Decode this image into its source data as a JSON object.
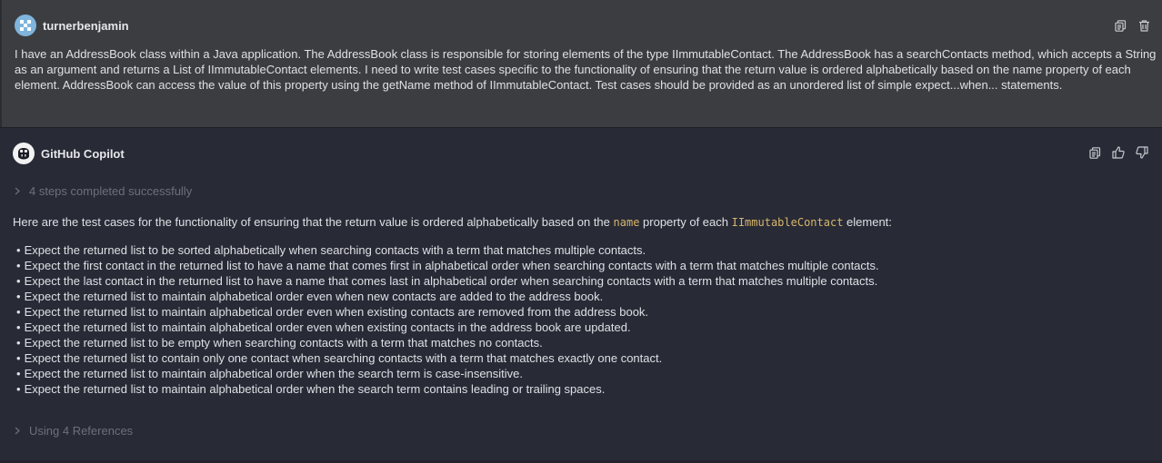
{
  "user_message": {
    "username": "turnerbenjamin",
    "text": "I have an AddressBook class within a Java application. The AddressBook class is responsible for storing elements of the type IImmutableContact. The AddressBook has a searchContacts method, which accepts a String as an argument and returns a List of IImmutableContact elements. I need to write test cases specific to the functionality of ensuring that the return value is ordered alphabetically based on the name property of each element. AddressBook can access the value of this property using the getName method of IImmutableContact. Test cases should be provided as an unordered list of simple expect...when... statements.",
    "actions": [
      "copy-icon",
      "trash-icon"
    ]
  },
  "bot_message": {
    "name": "GitHub Copilot",
    "actions": [
      "copy-icon",
      "thumbs-up-icon",
      "thumbs-down-icon"
    ],
    "steps_label": "4 steps completed successfully",
    "intro": {
      "before": "Here are the test cases for the functionality of ensuring that the return value is ordered alphabetically based on the ",
      "code1": "name",
      "middle": " property of each ",
      "code2": "IImmutableContact",
      "after": " element:"
    },
    "test_cases": [
      "Expect the returned list to be sorted alphabetically when searching contacts with a term that matches multiple contacts.",
      "Expect the first contact in the returned list to have a name that comes first in alphabetical order when searching contacts with a term that matches multiple contacts.",
      "Expect the last contact in the returned list to have a name that comes last in alphabetical order when searching contacts with a term that matches multiple contacts.",
      "Expect the returned list to maintain alphabetical order even when new contacts are added to the address book.",
      "Expect the returned list to maintain alphabetical order even when existing contacts are removed from the address book.",
      "Expect the returned list to maintain alphabetical order even when existing contacts in the address book are updated.",
      "Expect the returned list to be empty when searching contacts with a term that matches no contacts.",
      "Expect the returned list to contain only one contact when searching contacts with a term that matches exactly one contact.",
      "Expect the returned list to maintain alphabetical order when the search term is case-insensitive.",
      "Expect the returned list to maintain alphabetical order when the search term contains leading or trailing spaces."
    ],
    "references_label": "Using 4 References"
  },
  "colors": {
    "user_bg": "#3c3d41",
    "bot_bg": "#282a36",
    "code_accent": "#d8b66c",
    "muted_text": "#6d707c"
  }
}
